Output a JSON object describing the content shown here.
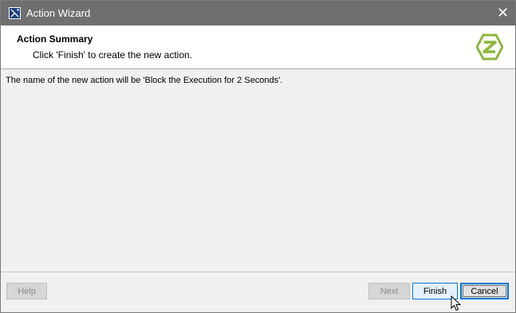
{
  "window": {
    "title": "Action Wizard",
    "close_glyph": "✕"
  },
  "header": {
    "title": "Action Summary",
    "subtitle": "Click 'Finish' to create the new action.",
    "logo_icon": "wizard-logo-icon"
  },
  "content": {
    "summary": "The name of the new action will be 'Block the Execution for 2 Seconds'."
  },
  "buttons": {
    "help": "Help",
    "next": "Next",
    "finish": "Finish",
    "cancel": "Cancel"
  },
  "colors": {
    "titlebar": "#6f6f6f",
    "accent": "#0078d7",
    "logo_green": "#8cb63c"
  }
}
